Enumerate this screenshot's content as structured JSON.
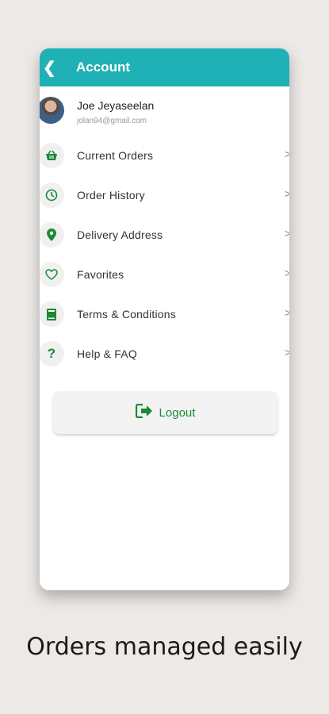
{
  "appbar": {
    "title": "Account"
  },
  "profile": {
    "name": "Joe Jeyaseelan",
    "email": "jolan94@gmail.com"
  },
  "menu": [
    {
      "label": "Current Orders",
      "icon": "basket-icon"
    },
    {
      "label": "Order History",
      "icon": "clock-icon"
    },
    {
      "label": "Delivery Address",
      "icon": "location-pin-icon"
    },
    {
      "label": "Favorites",
      "icon": "heart-icon"
    },
    {
      "label": "Terms & Conditions",
      "icon": "book-icon"
    },
    {
      "label": "Help & FAQ",
      "icon": "question-icon"
    }
  ],
  "logout": {
    "label": "Logout",
    "icon": "logout-icon"
  },
  "caption": "Orders managed easily",
  "colors": {
    "accent": "#1fb1b5",
    "icon_green": "#1c8a35"
  }
}
